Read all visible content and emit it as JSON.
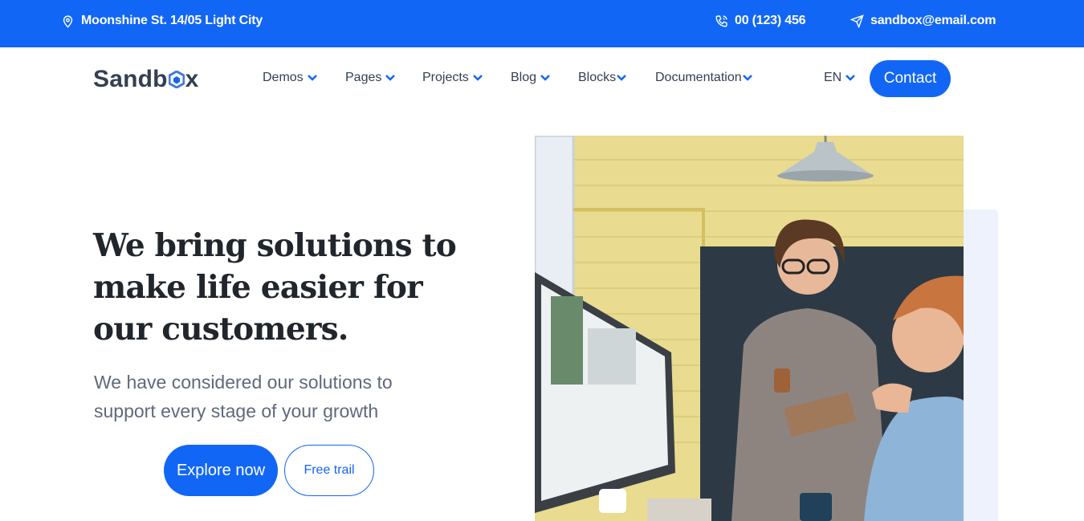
{
  "topbar": {
    "address": "Moonshine St. 14/05 Light City",
    "phone": "00 (123) 456",
    "email": "sandbox@email.com"
  },
  "brand": {
    "logo_prefix": "Sandb",
    "logo_suffix": "x"
  },
  "nav": {
    "items": [
      {
        "label": "Demos"
      },
      {
        "label": "Pages"
      },
      {
        "label": "Projects"
      },
      {
        "label": "Blog"
      },
      {
        "label": "Blocks"
      },
      {
        "label": "Documentation"
      }
    ],
    "language": "EN",
    "contact_label": "Contact"
  },
  "hero": {
    "title_line1": "We bring solutions to",
    "title_line2": "make life easier for",
    "title_line3": "our customers.",
    "subtitle_line1": "We have considered our solutions to",
    "subtitle_line2": "support every stage of your growth",
    "primary_button": "Explore now",
    "secondary_button": "Free trail"
  },
  "colors": {
    "accent": "#1166f5",
    "heading": "#21262c",
    "body_text": "#60697b",
    "soft_card": "#edf2fc"
  },
  "icons": {
    "address": "map-pin-icon",
    "phone": "phone-icon",
    "email": "send-icon",
    "dropdown": "chevron-down-icon"
  }
}
